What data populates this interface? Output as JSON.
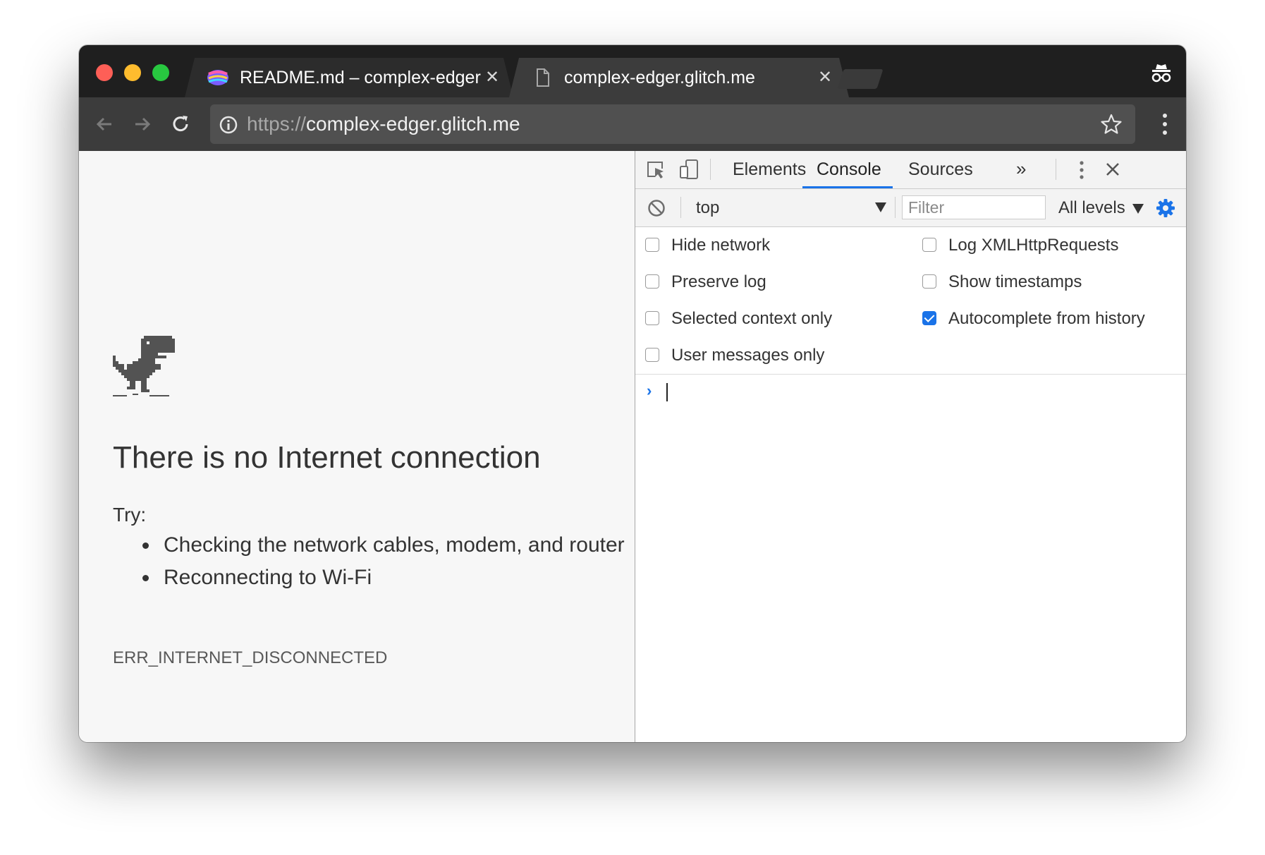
{
  "window": {
    "tabs": [
      {
        "title": "README.md – complex-edger",
        "active": false,
        "favicon": "glitch-fish-icon"
      },
      {
        "title": "complex-edger.glitch.me",
        "active": true,
        "favicon": "document-icon"
      }
    ]
  },
  "toolbar": {
    "url_scheme": "https://",
    "url_host": "complex-edger.glitch.me"
  },
  "page": {
    "title": "There is no Internet connection",
    "try_label": "Try:",
    "suggestions": [
      "Checking the network cables, modem, and router",
      "Reconnecting to Wi-Fi"
    ],
    "error_code": "ERR_INTERNET_DISCONNECTED"
  },
  "devtools": {
    "tabs": [
      "Elements",
      "Console",
      "Sources"
    ],
    "active_tab": "Console",
    "context": "top",
    "filter_placeholder": "Filter",
    "levels": "All levels",
    "accent_color": "#1a73e8",
    "settings": {
      "left": [
        {
          "label": "Hide network",
          "checked": false
        },
        {
          "label": "Preserve log",
          "checked": false
        },
        {
          "label": "Selected context only",
          "checked": false
        },
        {
          "label": "User messages only",
          "checked": false
        }
      ],
      "right": [
        {
          "label": "Log XMLHttpRequests",
          "checked": false
        },
        {
          "label": "Show timestamps",
          "checked": false
        },
        {
          "label": "Autocomplete from history",
          "checked": true
        }
      ]
    }
  }
}
